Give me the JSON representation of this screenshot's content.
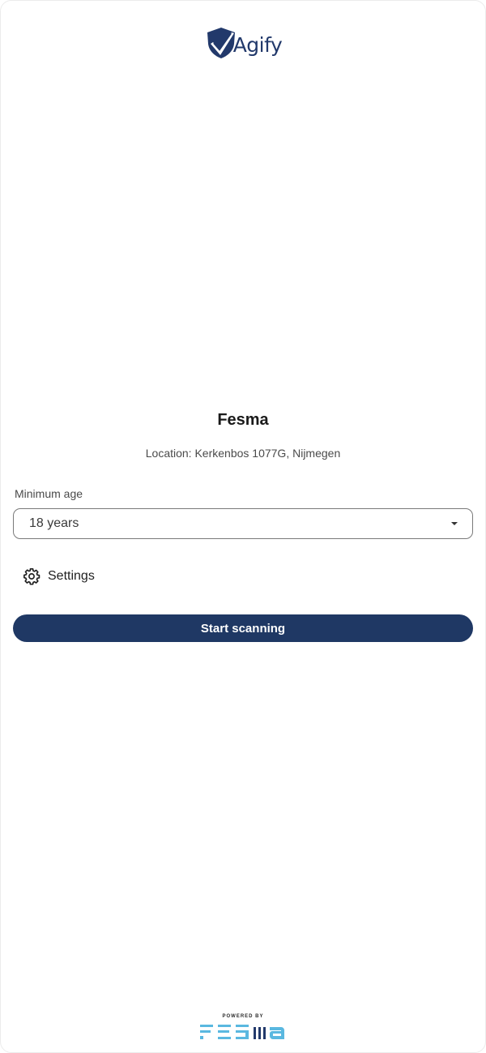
{
  "brand": {
    "logo_text": "Agify",
    "logo_icon": "shield-check-icon",
    "color": "#22396b"
  },
  "venue": {
    "name": "Fesma",
    "location": "Location: Kerkenbos 1077G, Nijmegen"
  },
  "form": {
    "min_age_label": "Minimum age",
    "min_age_value": "18 years",
    "settings_label": "Settings",
    "settings_icon": "gear-icon"
  },
  "actions": {
    "start_label": "Start scanning",
    "button_color": "#1f3864"
  },
  "footer": {
    "powered_by": "POWERED BY",
    "partner_logo_text": "FESMA",
    "partner_color": "#5ab8e0"
  }
}
